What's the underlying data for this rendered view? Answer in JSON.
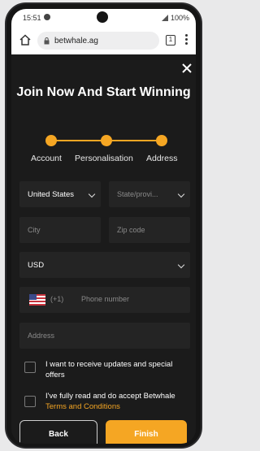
{
  "status": {
    "time": "15:51",
    "battery": "100%"
  },
  "browser": {
    "url": "betwhale.ag",
    "tab_count": "1"
  },
  "form": {
    "title": "Join Now And Start Winning",
    "steps": [
      "Account",
      "Personalisation",
      "Address"
    ],
    "country": "United States",
    "state_placeholder": "State/provi...",
    "city_placeholder": "City",
    "zip_placeholder": "Zip code",
    "currency": "USD",
    "phone_code": "(+1)",
    "phone_placeholder": "Phone number",
    "address_placeholder": "Address",
    "updates_label": "I want to receive updates and special offers",
    "terms_prefix": "I've fully read and do accept Betwhale",
    "terms_link": "Terms and Conditions",
    "back_label": "Back",
    "finish_label": "Finish"
  },
  "colors": {
    "accent": "#f5a623",
    "background": "#1b1b1b",
    "field": "#242424"
  }
}
